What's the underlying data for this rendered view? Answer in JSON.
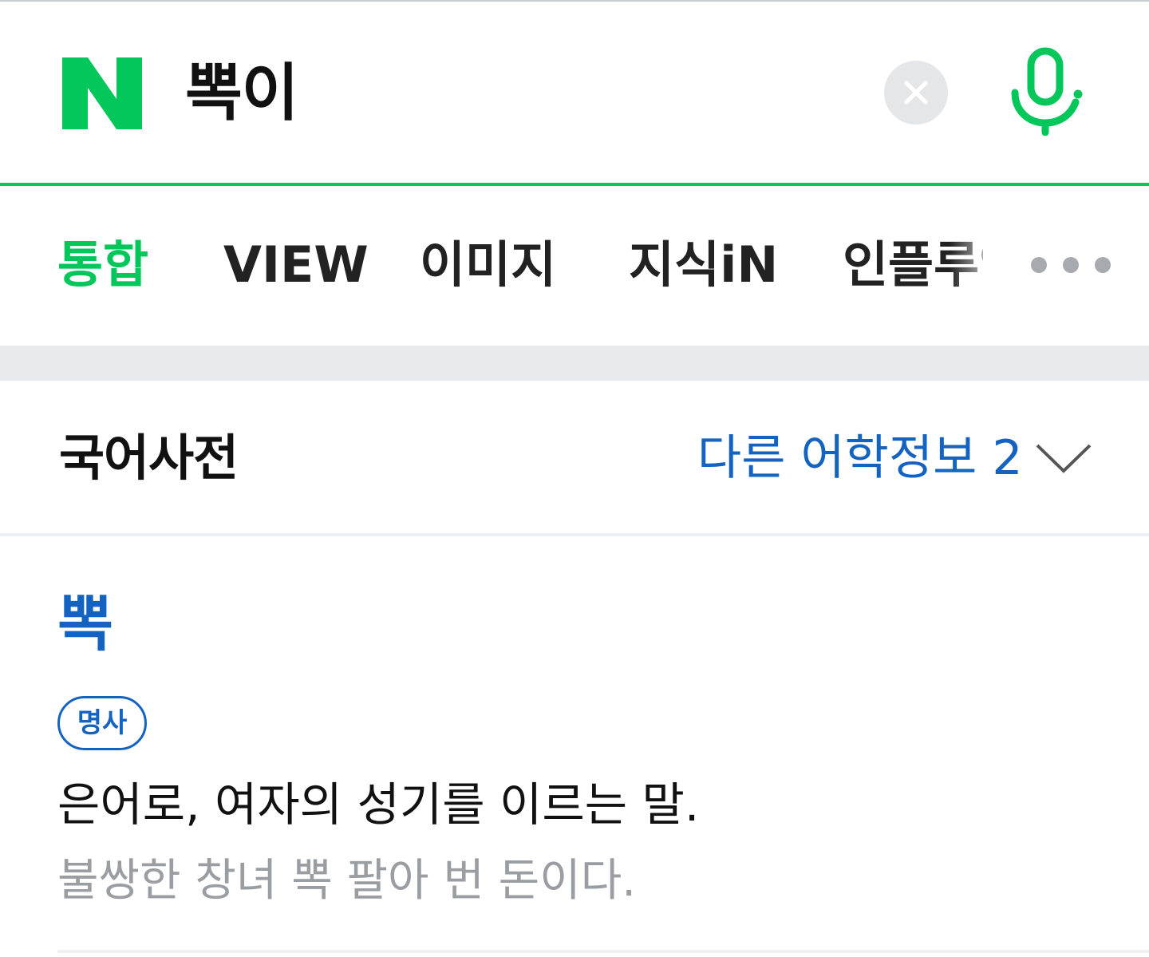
{
  "search": {
    "logo_label": "N",
    "query": "뽁이",
    "clear_icon": "close-icon",
    "voice_icon": "microphone-icon",
    "accent_color": "#03c75a"
  },
  "tabs": [
    {
      "label": "통합",
      "active": true
    },
    {
      "label": "VIEW",
      "active": false
    },
    {
      "label": "이미지",
      "active": false
    },
    {
      "label": "지식iN",
      "active": false
    },
    {
      "label": "인플루언서",
      "active": false
    }
  ],
  "more_icon": "more-dots-icon",
  "dictionary": {
    "title": "국어사전",
    "other_info_label": "다른 어학정보 2",
    "expand_icon": "chevron-down-icon",
    "entry": {
      "word": "뽁",
      "part_of_speech": "명사",
      "definition": "은어로, 여자의 성기를 이르는 말.",
      "example": "불쌍한 창녀 뽁 팔아 번 돈이다."
    },
    "link_color": "#1563c0"
  }
}
